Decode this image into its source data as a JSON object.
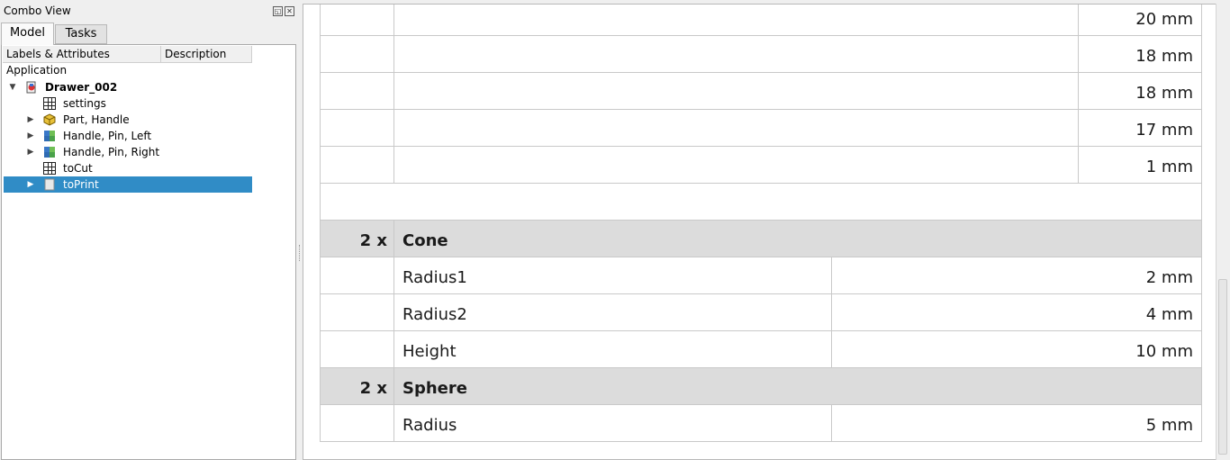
{
  "combo_view": {
    "title": "Combo View",
    "float_icon": "float-icon",
    "close_icon": "close-icon",
    "tabs": [
      {
        "label": "Model",
        "active": true
      },
      {
        "label": "Tasks",
        "active": false
      }
    ],
    "columns": [
      "Labels & Attributes",
      "Description"
    ],
    "root_label": "Application",
    "tree": [
      {
        "label": "Drawer_002",
        "icon": "document-icon",
        "expander": "expanded",
        "bold": true
      },
      {
        "label": "settings",
        "icon": "spreadsheet-icon",
        "expander": "none"
      },
      {
        "label": "Part, Handle",
        "icon": "part-icon",
        "expander": "collapsed"
      },
      {
        "label": "Handle, Pin, Left",
        "icon": "link-icon",
        "expander": "collapsed"
      },
      {
        "label": "Handle, Pin, Right",
        "icon": "link-icon",
        "expander": "collapsed"
      },
      {
        "label": "toCut",
        "icon": "spreadsheet-icon",
        "expander": "none"
      },
      {
        "label": "toPrint",
        "icon": "page-icon",
        "expander": "collapsed",
        "selected": true
      }
    ]
  },
  "report": {
    "rows": [
      {
        "type": "value",
        "qty": "",
        "name": "",
        "value": "20 mm",
        "wide_name": true
      },
      {
        "type": "value",
        "qty": "",
        "name": "",
        "value": "18 mm",
        "wide_name": true
      },
      {
        "type": "value",
        "qty": "",
        "name": "",
        "value": "18 mm",
        "wide_name": true
      },
      {
        "type": "value",
        "qty": "",
        "name": "",
        "value": "17 mm",
        "wide_name": true
      },
      {
        "type": "value",
        "qty": "",
        "name": "",
        "value": "1 mm",
        "wide_name": true
      },
      {
        "type": "blank"
      },
      {
        "type": "header",
        "qty": "2 x",
        "name": "Cone"
      },
      {
        "type": "value",
        "qty": "",
        "name": "Radius1",
        "value": "2 mm"
      },
      {
        "type": "value",
        "qty": "",
        "name": "Radius2",
        "value": "4 mm"
      },
      {
        "type": "value",
        "qty": "",
        "name": "Height",
        "value": "10 mm"
      },
      {
        "type": "header",
        "qty": "2 x",
        "name": "Sphere"
      },
      {
        "type": "value",
        "qty": "",
        "name": "Radius",
        "value": "5 mm"
      }
    ]
  },
  "colors": {
    "selection": "#308cc6",
    "header_row": "#dcdcdc",
    "grid": "#c9c9c9"
  }
}
